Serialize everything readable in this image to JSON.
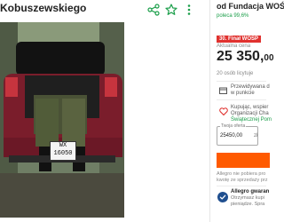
{
  "listing": {
    "title": "Kobuszewskiego"
  },
  "photo": {
    "plate_line1": "WX",
    "plate_line2": "16050"
  },
  "seller": {
    "name": "od Fundacja WOŚ",
    "recommend": "poleca 99,6%"
  },
  "offer": {
    "badge": "30. Finał WOŚP",
    "price_label": "Aktualna cena",
    "price_main": "25 350,",
    "price_fraction": "00",
    "bids": "20 osób licytuje"
  },
  "delivery": {
    "pickup_line1": "Przewidywana d",
    "pickup_line2": "w punkcie"
  },
  "charity": {
    "line1": "Kupując, wspier",
    "line2": "Organizacji Cha",
    "link": "Świątecznej Pom"
  },
  "bid_form": {
    "label": "Twoja oferta",
    "value": "25450,00",
    "currency": "zł"
  },
  "disclaimer": {
    "line1": "Allegro nie pobiera pro",
    "line2": "kwotę ze sprzedaży prz"
  },
  "guarantee": {
    "title": "Allegro gwaran",
    "line1": "Otrzymasz kupi",
    "line2": "pieniądze. Spra"
  },
  "colors": {
    "accent_orange": "#ff5a00",
    "badge_red": "#e0322f",
    "link_green": "#1a9e49"
  }
}
